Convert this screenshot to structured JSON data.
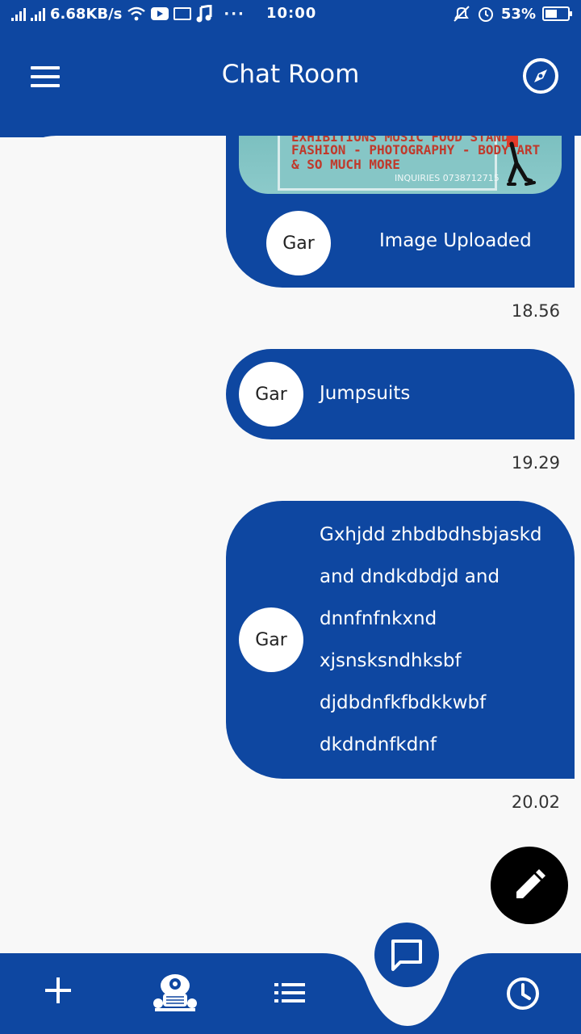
{
  "status_bar": {
    "network_speed": "6.68KB/s",
    "time": "10:00",
    "battery": "53%",
    "icons": [
      "signal-icon",
      "wifi-icon",
      "youtube-icon",
      "mail-icon",
      "music-icon",
      "more-icon",
      "mute-icon",
      "alarm-icon",
      "battery-icon"
    ]
  },
  "header": {
    "title": "Chat Room",
    "left_icon": "menu-icon",
    "right_icon": "compass-icon"
  },
  "messages": [
    {
      "avatar": "Gar",
      "text": "Image Uploaded",
      "time": "18.56",
      "image": {
        "lines": [
          "EXHIBITIONS MUSIC FOOD STANDS",
          "FASHION - PHOTOGRAPHY - BODY ART",
          "& SO MUCH MORE"
        ],
        "inquiries": "INQUIRIES 0738712715"
      }
    },
    {
      "avatar": "Gar",
      "text": "Jumpsuits",
      "time": "19.29"
    },
    {
      "avatar": "Gar",
      "lines": [
        "Gxhjdd zhbdbdhsbjaskd",
        "and dndkdbdjd and",
        "dnnfnfnkxnd",
        "xjsnsksndhksbf",
        "djdbdnfkfbdkkwbf",
        "dkdndnfkdnf"
      ],
      "time": "20.02"
    }
  ],
  "fab": {
    "icon": "pencil-icon"
  },
  "bottom_nav": {
    "items": [
      "plus-icon",
      "mascot-icon",
      "list-icon",
      "chat-icon",
      "clock-icon"
    ],
    "colors": {
      "primary": "#0e47a1",
      "background": "#f8f8f8"
    }
  }
}
